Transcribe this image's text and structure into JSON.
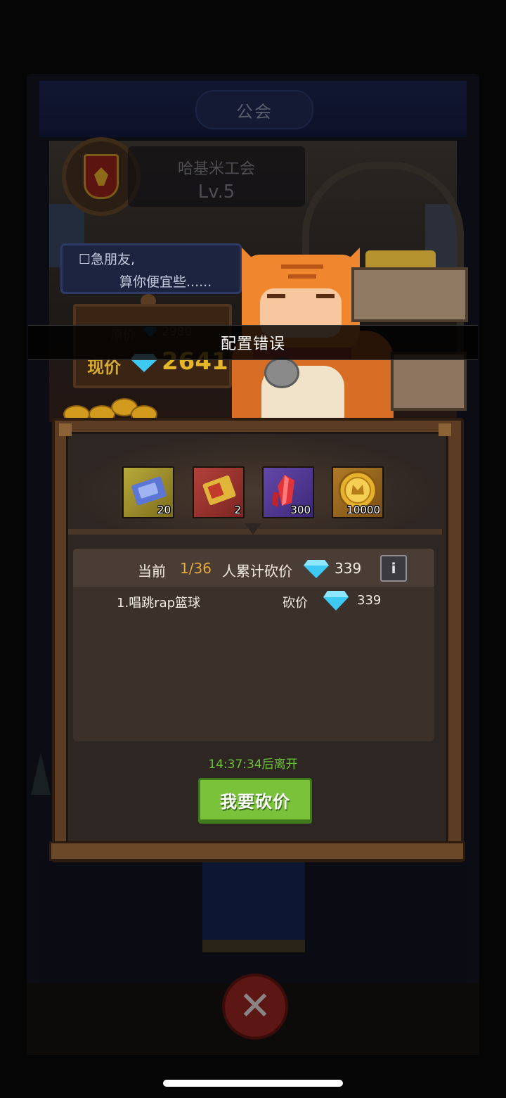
{
  "header": {
    "title": "公会"
  },
  "guild": {
    "name": "哈基米工会",
    "level": "Lv.5"
  },
  "merchant": {
    "speech_line1": "☐急朋友,",
    "speech_line2": "算你便宜些......",
    "original_price_label": "原价",
    "original_price": "2980",
    "current_price_label": "现价",
    "current_price": "2641"
  },
  "toast": {
    "message": "配置错误"
  },
  "rewards": [
    {
      "icon": "ticket-icon",
      "count": "20"
    },
    {
      "icon": "card-icon",
      "count": "2"
    },
    {
      "icon": "red-crystal-icon",
      "count": "300"
    },
    {
      "icon": "gold-coin-icon",
      "count": "10000"
    }
  ],
  "bargain": {
    "current_label": "当前",
    "progress": "1/36",
    "total_label": "人累计砍价",
    "total_value": "339",
    "info_label": "i",
    "records": [
      {
        "name": "1.唱跳rap篮球",
        "action": "砍价",
        "value": "339"
      }
    ]
  },
  "timer": "14:37:34后离开",
  "button": {
    "bargain_label": "我要砍价",
    "close_label": "✕"
  },
  "colors": {
    "accent_green": "#7ac23a",
    "timer_green": "#6dc23a",
    "progress_orange": "#e8a83a",
    "price_gold": "#e6b629",
    "gem_blue": "#3ec9f5"
  }
}
